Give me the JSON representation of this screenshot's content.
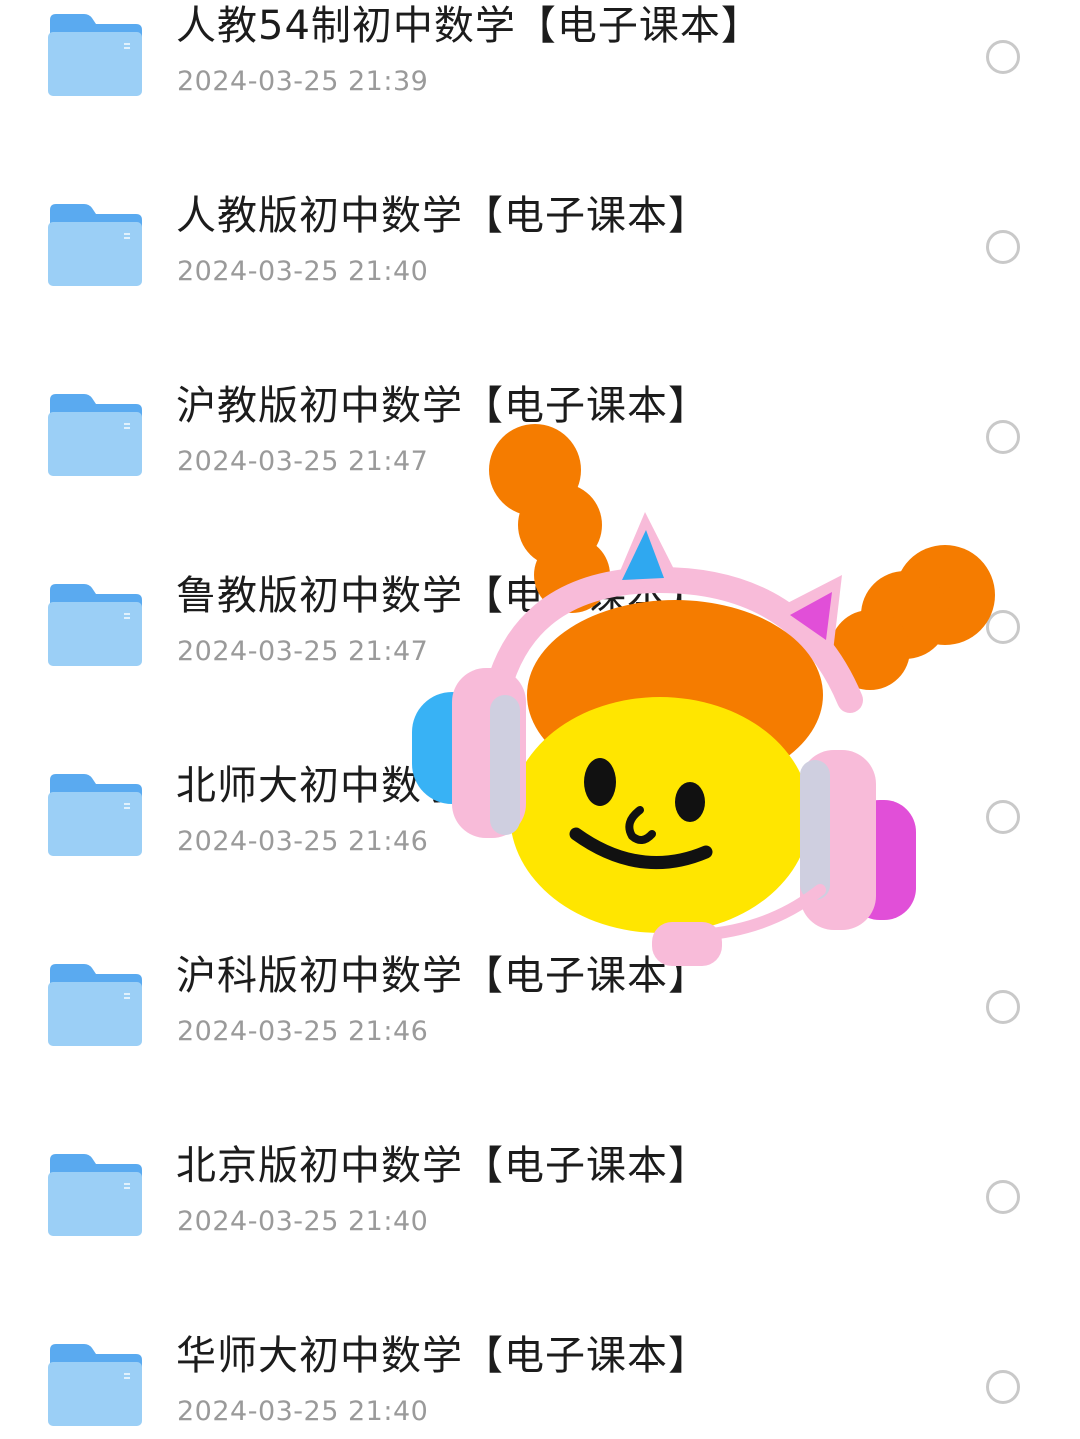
{
  "colors": {
    "folder_front": "#8ec9f5",
    "folder_back": "#5aaaf0",
    "name_text": "#1c1c1c",
    "date_text": "#9a9a9a",
    "radio_border": "#c9c9c9"
  },
  "files": [
    {
      "name": "人教54制初中数学【电子课本】",
      "date": "2024-03-25 21:39",
      "icon": "folder-icon"
    },
    {
      "name": "人教版初中数学【电子课本】",
      "date": "2024-03-25 21:40",
      "icon": "folder-icon"
    },
    {
      "name": "沪教版初中数学【电子课本】",
      "date": "2024-03-25 21:47",
      "icon": "folder-icon"
    },
    {
      "name": "鲁教版初中数学【电子课本】",
      "date": "2024-03-25 21:47",
      "icon": "folder-icon"
    },
    {
      "name": "北师大初中数学【电子课本】",
      "date": "2024-03-25 21:46",
      "icon": "folder-icon"
    },
    {
      "name": "沪科版初中数学【电子课本】",
      "date": "2024-03-25 21:46",
      "icon": "folder-icon"
    },
    {
      "name": "北京版初中数学【电子课本】",
      "date": "2024-03-25 21:40",
      "icon": "folder-icon"
    },
    {
      "name": "华师大初中数学【电子课本】",
      "date": "2024-03-25 21:40",
      "icon": "folder-icon"
    }
  ],
  "sticker": {
    "icon": "headset-character-sticker-icon"
  }
}
